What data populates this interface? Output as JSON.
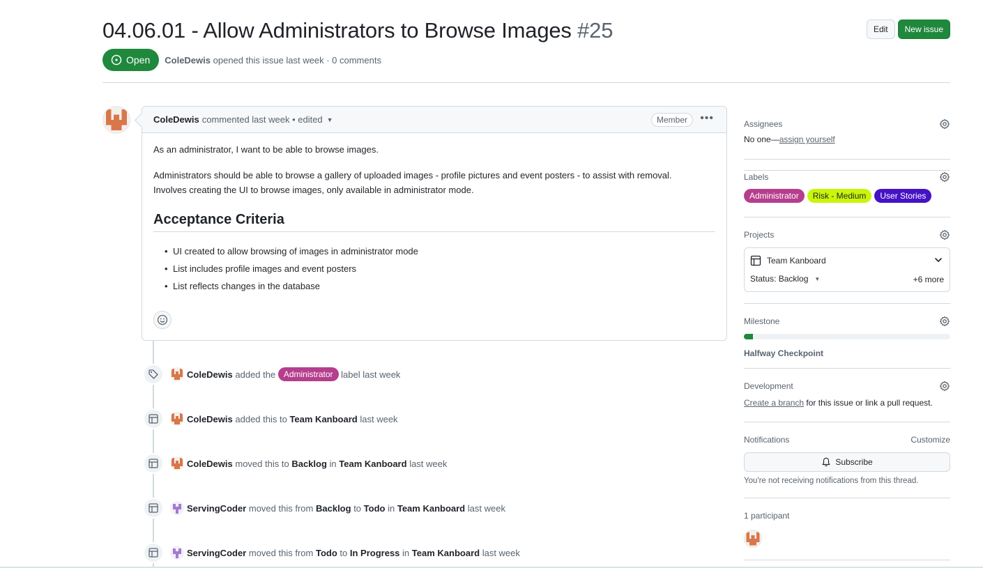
{
  "issue": {
    "title": "04.06.01 - Allow Administrators to Browse Images",
    "number": "#25",
    "state": "Open",
    "author": "ColeDewis",
    "meta_suffix": "opened this issue last week · 0 comments",
    "edit_label": "Edit",
    "new_issue_label": "New issue"
  },
  "comment": {
    "author": "ColeDewis",
    "meta": "commented last week • edited",
    "role_badge": "Member",
    "p1": "As an administrator, I want to be able to browse images.",
    "p2": "Administrators should be able to browse a gallery of uploaded images - profile pictures and event posters - to assist with removal.",
    "p3": "Involves creating the UI to browse images, only available in administrator mode.",
    "heading": "Acceptance Criteria",
    "criteria": [
      "UI created to allow browsing of images in administrator mode",
      "List includes profile images and event posters",
      "List reflects changes in the database"
    ]
  },
  "timeline": [
    {
      "icon": "tag-icon",
      "actor": "ColeDewis",
      "t1": "added the",
      "label": "Administrator",
      "t2": "label last week"
    },
    {
      "icon": "table-icon",
      "actor": "ColeDewis",
      "t1": "added this to",
      "project": "Team Kanboard",
      "t2": "last week"
    },
    {
      "icon": "table-icon",
      "actor": "ColeDewis",
      "t1": "moved this to",
      "to": "Backlog",
      "t_in": "in",
      "project": "Team Kanboard",
      "t2": "last week"
    },
    {
      "icon": "table-icon",
      "actor": "ServingCoder",
      "t1": "moved this from",
      "from": "Backlog",
      "t_to": "to",
      "to": "Todo",
      "t_in": "in",
      "project": "Team Kanboard",
      "t2": "last week"
    },
    {
      "icon": "table-icon",
      "actor": "ServingCoder",
      "t1": "moved this from",
      "from": "Todo",
      "t_to": "to",
      "to": "In Progress",
      "t_in": "in",
      "project": "Team Kanboard",
      "t2": "last week"
    }
  ],
  "sidebar": {
    "assignees": {
      "title": "Assignees",
      "none": "No one—",
      "assign_link": "assign yourself"
    },
    "labels": {
      "title": "Labels",
      "items": [
        {
          "text": "Administrator",
          "bg": "#b53e8d",
          "fg": "#ffffff"
        },
        {
          "text": "Risk - Medium",
          "bg": "#c9f50a",
          "fg": "#1f2328"
        },
        {
          "text": "User Stories",
          "bg": "#4512c5",
          "fg": "#ffffff"
        }
      ]
    },
    "projects": {
      "title": "Projects",
      "name": "Team Kanboard",
      "status": "Status: Backlog",
      "more": "+6 more"
    },
    "milestone": {
      "title": "Milestone",
      "name": "Halfway Checkpoint",
      "progress": 0.045
    },
    "development": {
      "title": "Development",
      "link": "Create a branch",
      "rest": "for this issue or link a pull request."
    },
    "notifications": {
      "title": "Notifications",
      "customize": "Customize",
      "button": "Subscribe",
      "note": "You're not receiving notifications from this thread."
    },
    "participants": {
      "title": "1 participant"
    }
  },
  "colors": {
    "open_green": "#1f883d",
    "link_blue": "#0969da",
    "admin_label": "#b53e8d"
  }
}
